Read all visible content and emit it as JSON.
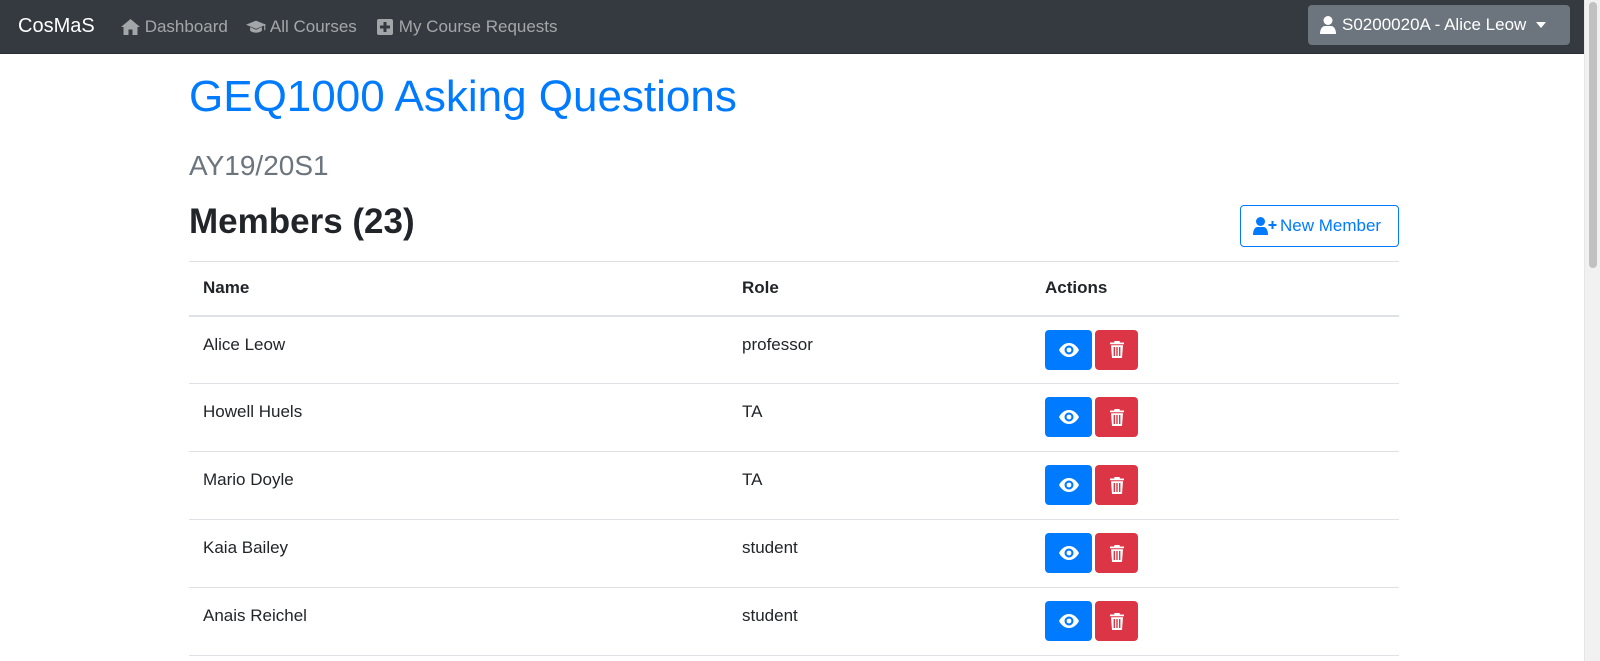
{
  "navbar": {
    "brand": "CosMaS",
    "items": [
      {
        "label": "Dashboard",
        "icon": "home-icon"
      },
      {
        "label": "All Courses",
        "icon": "graduation-cap-icon"
      },
      {
        "label": "My Course Requests",
        "icon": "plus-square-icon"
      }
    ],
    "user": {
      "label": "S0200020A - Alice Leow",
      "icon": "user-icon"
    }
  },
  "course": {
    "title": "GEQ1000 Asking Questions",
    "semester": "AY19/20S1"
  },
  "members": {
    "heading": "Members (23)",
    "new_button_label": "New Member",
    "columns": [
      "Name",
      "Role",
      "Actions"
    ],
    "rows": [
      {
        "name": "Alice Leow",
        "role": "professor"
      },
      {
        "name": "Howell Huels",
        "role": "TA"
      },
      {
        "name": "Mario Doyle",
        "role": "TA"
      },
      {
        "name": "Kaia Bailey",
        "role": "student"
      },
      {
        "name": "Anais Reichel",
        "role": "student"
      }
    ]
  },
  "colors": {
    "navbar_bg": "#343a40",
    "primary": "#007bff",
    "danger": "#dc3545",
    "secondary": "#6c757d"
  }
}
